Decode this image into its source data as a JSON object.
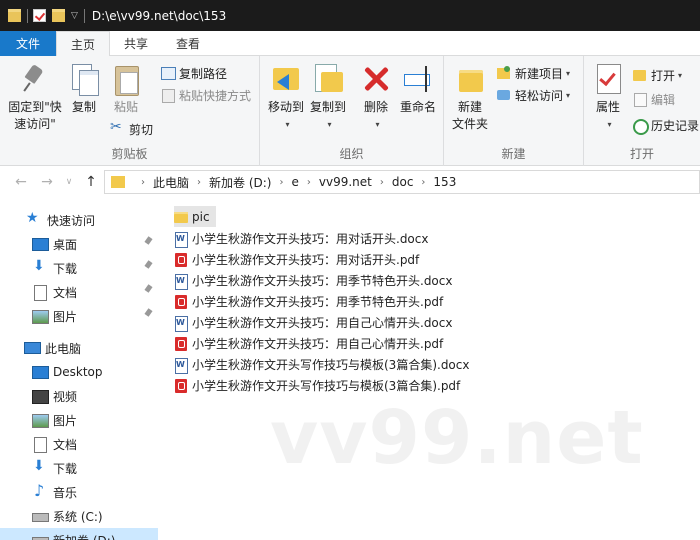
{
  "titlebar": {
    "path": "D:\\e\\vv99.net\\doc\\153"
  },
  "tabs": [
    {
      "label": "文件"
    },
    {
      "label": "主页"
    },
    {
      "label": "共享"
    },
    {
      "label": "查看"
    }
  ],
  "ribbon": {
    "clipboard": {
      "group_label": "剪贴板",
      "pin_label_1": "固定到\"快",
      "pin_label_2": "速访问\"",
      "copy_label": "复制",
      "paste_label": "粘贴",
      "copy_path_label": "复制路径",
      "paste_shortcut_label": "粘贴快捷方式",
      "cut_label": "剪切"
    },
    "organize": {
      "group_label": "组织",
      "move_to_label": "移动到",
      "copy_to_label": "复制到",
      "delete_label": "删除",
      "rename_label": "重命名"
    },
    "new": {
      "group_label": "新建",
      "new_folder_label_1": "新建",
      "new_folder_label_2": "文件夹",
      "new_item_label": "新建项目",
      "easy_access_label": "轻松访问"
    },
    "open": {
      "group_label": "打开",
      "properties_label": "属性",
      "open_label": "打开",
      "edit_label": "编辑",
      "history_label": "历史记录"
    }
  },
  "address": {
    "crumbs": [
      "此电脑",
      "新加卷 (D:)",
      "e",
      "vv99.net",
      "doc",
      "153"
    ]
  },
  "navpane": {
    "items": [
      {
        "label": "快速访问",
        "icon": "star-icon"
      },
      {
        "label": "桌面",
        "icon": "desktop-icon"
      },
      {
        "label": "下载",
        "icon": "download-icon"
      },
      {
        "label": "文档",
        "icon": "document-icon"
      },
      {
        "label": "图片",
        "icon": "picture-icon"
      },
      {
        "label": "此电脑",
        "icon": "computer-icon"
      },
      {
        "label": "Desktop",
        "icon": "desktop-icon"
      },
      {
        "label": "视频",
        "icon": "video-icon"
      },
      {
        "label": "图片",
        "icon": "picture-icon"
      },
      {
        "label": "文档",
        "icon": "document-icon"
      },
      {
        "label": "下载",
        "icon": "download-icon"
      },
      {
        "label": "音乐",
        "icon": "music-icon"
      },
      {
        "label": "系统 (C:)",
        "icon": "drive-icon"
      },
      {
        "label": "新加卷 (D:)",
        "icon": "drive-icon"
      }
    ]
  },
  "files": [
    {
      "name": "pic",
      "type": "folder"
    },
    {
      "name": "小学生秋游作文开头技巧：用对话开头.docx",
      "type": "docx"
    },
    {
      "name": "小学生秋游作文开头技巧：用对话开头.pdf",
      "type": "pdf"
    },
    {
      "name": "小学生秋游作文开头技巧：用季节特色开头.docx",
      "type": "docx"
    },
    {
      "name": "小学生秋游作文开头技巧：用季节特色开头.pdf",
      "type": "pdf"
    },
    {
      "name": "小学生秋游作文开头技巧：用自己心情开头.docx",
      "type": "docx"
    },
    {
      "name": "小学生秋游作文开头技巧：用自己心情开头.pdf",
      "type": "pdf"
    },
    {
      "name": "小学生秋游作文开头写作技巧与模板(3篇合集).docx",
      "type": "docx"
    },
    {
      "name": "小学生秋游作文开头写作技巧与模板(3篇合集).pdf",
      "type": "pdf"
    }
  ],
  "watermark": "vv99.net"
}
